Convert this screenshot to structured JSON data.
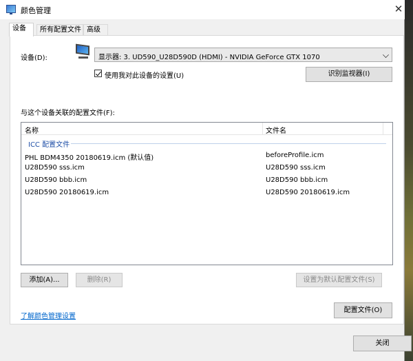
{
  "window": {
    "title": "颜色管理",
    "close_glyph": "✕"
  },
  "tabs": [
    {
      "label": "设备",
      "active": true
    },
    {
      "label": "所有配置文件",
      "active": false
    },
    {
      "label": "高级",
      "active": false
    }
  ],
  "device": {
    "label": "设备(D):",
    "selected": "显示器: 3. UD590_U28D590D (HDMI) - NVIDIA GeForce GTX 1070",
    "use_my_settings_label": "使用我对此设备的设置(U)",
    "use_my_settings_checked": true,
    "identify_button": "识别监视器(I)"
  },
  "profiles": {
    "section_label": "与这个设备关联的配置文件(F):",
    "columns": [
      "名称",
      "文件名"
    ],
    "group_label": "ICC 配置文件",
    "rows": [
      {
        "name": "PHL BDM4350 20180619.icm (默认值)",
        "file": "beforeProfile.icm"
      },
      {
        "name": "U28D590 sss.icm",
        "file": "U28D590 sss.icm"
      },
      {
        "name": "U28D590 bbb.icm",
        "file": "U28D590 bbb.icm"
      },
      {
        "name": "U28D590 20180619.icm",
        "file": "U28D590 20180619.icm"
      }
    ]
  },
  "buttons": {
    "add": "添加(A)...",
    "remove": "删除(R)",
    "set_default": "设置为默认配置文件(S)",
    "profiles": "配置文件(O)",
    "close": "关闭"
  },
  "link": {
    "text": "了解颜色管理设置"
  },
  "icons": {
    "window_icon": "color-management-icon",
    "monitor": "monitor-icon",
    "dropdown": "chevron-down-icon"
  }
}
